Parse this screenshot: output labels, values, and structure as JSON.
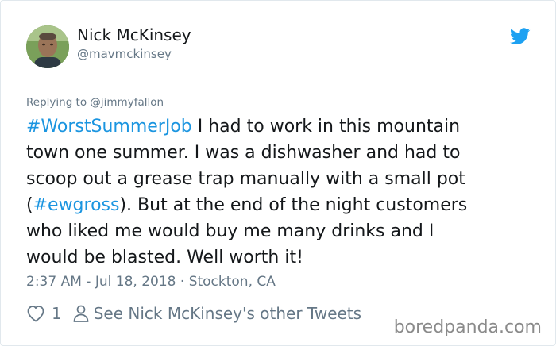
{
  "user": {
    "display_name": "Nick McKinsey",
    "handle": "@mavmckinsey"
  },
  "icons": {
    "brand": "twitter-bird-icon",
    "like": "heart-icon",
    "profile": "person-icon"
  },
  "colors": {
    "link": "#1b95e0",
    "twitter_blue": "#1da1f2",
    "muted": "#657786",
    "text": "#14171a"
  },
  "reply": {
    "prefix": "Replying to",
    "mention": "@jimmyfallon"
  },
  "tweet": {
    "hashtag1": "#WorstSummerJob",
    "line1_rest": " I had to work in this mountain",
    "line2": "town one summer. I was a dishwasher and had to",
    "line3": "scoop out a grease trap manually with a small pot",
    "line4_open": "(",
    "hashtag2": "#ewgross",
    "line4_rest": "). But at the end of the night customers",
    "line5": "who liked me would buy me many drinks and I",
    "line6": "would be blasted. Well worth it!"
  },
  "meta": {
    "time": "2:37 AM",
    "date": "Jul 18, 2018",
    "location": "Stockton, CA",
    "separator_dash": " - ",
    "separator_dot": " · "
  },
  "actions": {
    "like_count": "1",
    "other_tweets_label": "See Nick McKinsey's other Tweets"
  },
  "watermark": "boredpanda.com"
}
